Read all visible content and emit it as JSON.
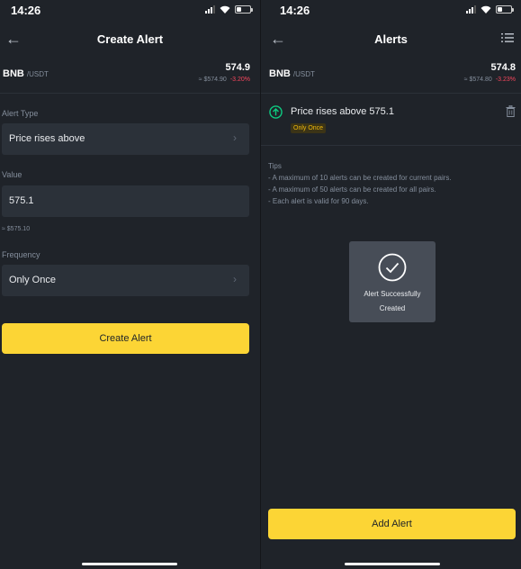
{
  "left": {
    "status": {
      "time": "14:26"
    },
    "nav": {
      "back_icon": "arrow-left-icon",
      "title": "Create Alert"
    },
    "pair": {
      "base": "BNB",
      "quote": "/USDT",
      "price": "574.9",
      "fiat": "≈ $574.90",
      "change": "-3.20%"
    },
    "alert_type": {
      "label": "Alert Type",
      "value": "Price rises above"
    },
    "value_field": {
      "label": "Value",
      "value": "575.1",
      "hint": "≈ $575.10"
    },
    "frequency": {
      "label": "Frequency",
      "value": "Only Once"
    },
    "create_button": "Create Alert"
  },
  "right": {
    "status": {
      "time": "14:26"
    },
    "nav": {
      "back_icon": "arrow-left-icon",
      "title": "Alerts",
      "menu_icon": "list-icon"
    },
    "pair": {
      "base": "BNB",
      "quote": "/USDT",
      "price": "574.8",
      "fiat": "≈ $574.80",
      "change": "-3.23%"
    },
    "alert": {
      "icon": "arrow-up-circle-icon",
      "text": "Price rises above 575.1",
      "badge": "Only Once"
    },
    "tips": {
      "title": "Tips",
      "items": [
        "- A maximum of 10 alerts can be created for current pairs.",
        "- A maximum of 50 alerts can be created for all pairs.",
        "- Each alert is valid for 90 days."
      ]
    },
    "toast": {
      "line1": "Alert Successfully",
      "line2": "Created"
    },
    "add_button": "Add Alert"
  },
  "colors": {
    "accent": "#fcd535",
    "negative": "#f6465d",
    "positive": "#0ecb81",
    "background": "#1f2329",
    "surface": "#2b3139"
  }
}
